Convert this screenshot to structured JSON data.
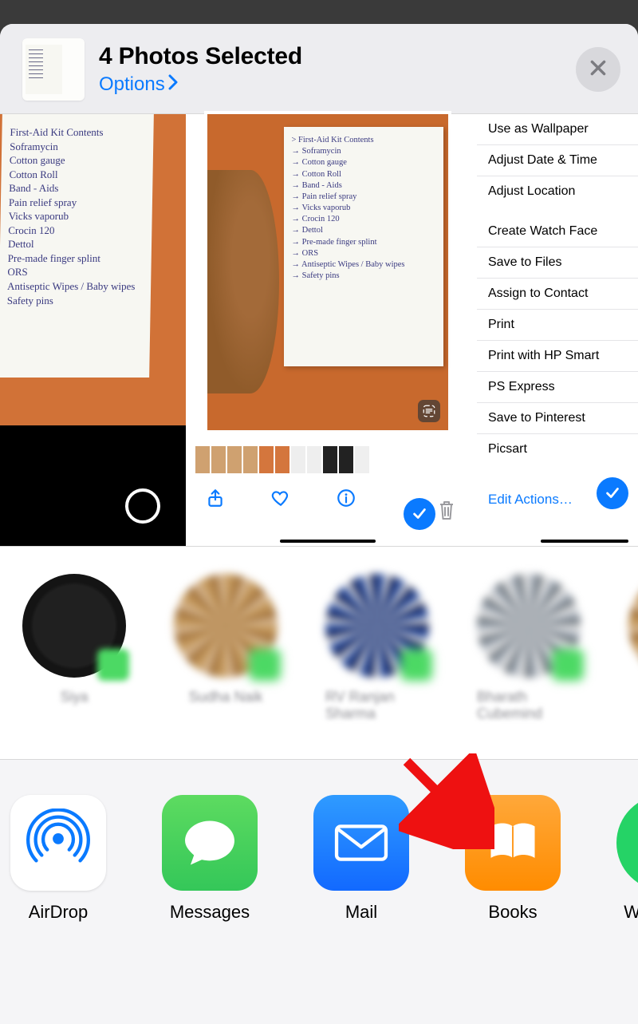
{
  "header": {
    "title": "4 Photos Selected",
    "options_label": "Options"
  },
  "photo_note": {
    "heading": "First-Aid Kit Contents",
    "lines": [
      "Soframycin",
      "Cotton gauge",
      "Cotton Roll",
      "Band - Aids",
      "Pain relief spray",
      "Vicks vaporub",
      "Crocin 120",
      "Dettol",
      "Pre-made finger splint",
      "ORS",
      "Antiseptic Wipes / Baby wipes",
      "Safety pins"
    ]
  },
  "actions": {
    "group1": [
      "Use as Wallpaper",
      "Adjust Date & Time",
      "Adjust Location"
    ],
    "group2": [
      "Create Watch Face",
      "Save to Files",
      "Assign to Contact",
      "Print",
      "Print with HP Smart",
      "PS Express",
      "Save to Pinterest",
      "Picsart"
    ],
    "edit_label": "Edit Actions…"
  },
  "contacts": [
    {
      "name": "Siya"
    },
    {
      "name": "Sudha Naik"
    },
    {
      "name": "RV Ranjan Sharma"
    },
    {
      "name": "Bharath Cubemind"
    }
  ],
  "apps": [
    {
      "label": "AirDrop"
    },
    {
      "label": "Messages"
    },
    {
      "label": "Mail"
    },
    {
      "label": "Books"
    },
    {
      "label": "WhatsApp"
    }
  ],
  "colors": {
    "accent": "#0a7aff",
    "selection_check": "#0a7aff",
    "contact_badge": "#4cd964"
  }
}
